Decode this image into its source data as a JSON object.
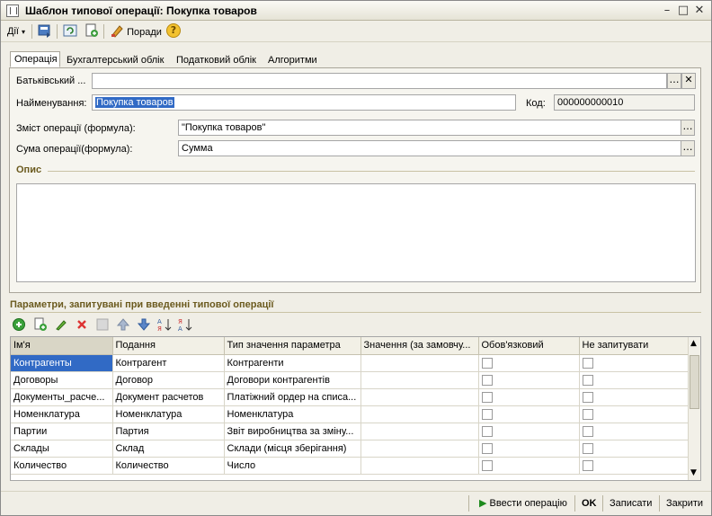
{
  "window": {
    "title": "Шаблон типової операції: Покупка товаров"
  },
  "toolbar": {
    "actions_label": "Дії",
    "hints_label": "Поради"
  },
  "tabs": [
    {
      "label": "Операція"
    },
    {
      "label": "Бухгалтерський облік"
    },
    {
      "label": "Податковий облік"
    },
    {
      "label": "Алгоритми"
    }
  ],
  "form": {
    "parent_label": "Батьківський ...",
    "parent_value": "",
    "name_label": "Найменування:",
    "name_value": "Покупка товаров",
    "code_label": "Код:",
    "code_value": "000000000010",
    "content_label": "Зміст операції (формула):",
    "content_value": "\"Покупка товаров\"",
    "sum_label": "Сума операції(формула):",
    "sum_value": "Сумма",
    "description_title": "Опис",
    "description_value": ""
  },
  "params": {
    "title": "Параметри, запитувані при введенні типової операції",
    "columns": [
      "Ім'я",
      "Подання",
      "Тип значення параметра",
      "Значення (за замовчу...",
      "Обов'язковий",
      "Не запитувати"
    ],
    "rows": [
      {
        "name": "Контрагенты",
        "view": "Контрагент",
        "type": "Контрагенти",
        "value": "",
        "required": false,
        "noask": false
      },
      {
        "name": "Договоры",
        "view": "Договор",
        "type": "Договори контрагентів",
        "value": "",
        "required": false,
        "noask": false
      },
      {
        "name": "Документы_расче...",
        "view": "Документ расчетов",
        "type": "Платіжний ордер на списа...",
        "value": "",
        "required": false,
        "noask": false
      },
      {
        "name": "Номенклатура",
        "view": "Номенклатура",
        "type": "Номенклатура",
        "value": "",
        "required": false,
        "noask": false
      },
      {
        "name": "Партии",
        "view": "Партия",
        "type": "Звіт виробництва за зміну...",
        "value": "",
        "required": false,
        "noask": false
      },
      {
        "name": "Склады",
        "view": "Склад",
        "type": "Склади (місця зберігання)",
        "value": "",
        "required": false,
        "noask": false
      },
      {
        "name": "Количество",
        "view": "Количество",
        "type": "Число",
        "value": "",
        "required": false,
        "noask": false
      }
    ]
  },
  "footer": {
    "enter_operation": "Ввести операцію",
    "ok": "OK",
    "save": "Записати",
    "close": "Закрити"
  },
  "colors": {
    "selection": "#316ac5",
    "section_title": "#6b5a1e",
    "window_bg": "#f0eee6"
  }
}
